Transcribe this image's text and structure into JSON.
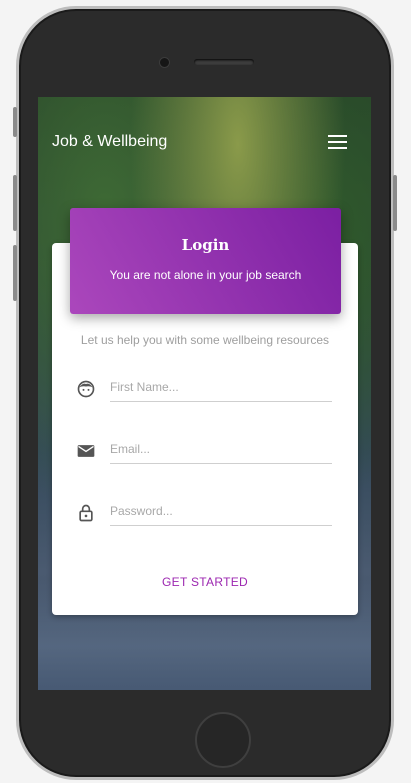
{
  "app": {
    "title": "Job & Wellbeing",
    "menu_icon": "hamburger-menu-icon"
  },
  "login": {
    "title": "Login",
    "subtitle": "You are not alone in your job search",
    "tagline": "Let us help you with some wellbeing resources",
    "fields": {
      "first_name": {
        "placeholder": "First Name...",
        "value": "",
        "icon": "face-icon"
      },
      "email": {
        "placeholder": "Email...",
        "value": "",
        "icon": "mail-icon"
      },
      "password": {
        "placeholder": "Password...",
        "value": "",
        "icon": "lock-icon"
      }
    },
    "submit_label": "GET STARTED"
  },
  "colors": {
    "accent": "#9c27b0",
    "header_gradient_start": "#ab47bc",
    "header_gradient_end": "#7b1fa2"
  }
}
